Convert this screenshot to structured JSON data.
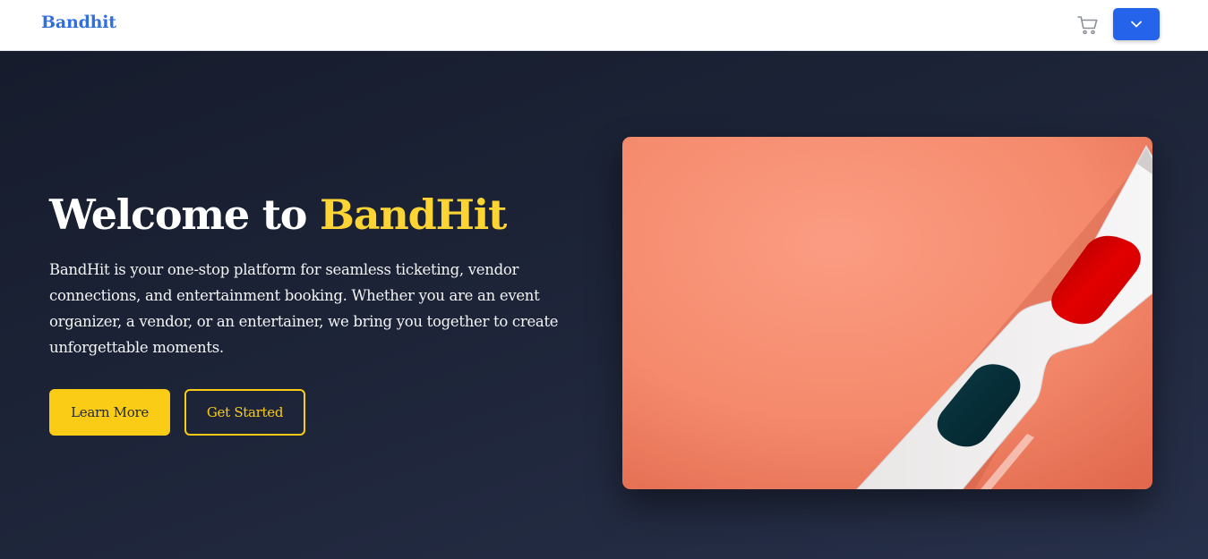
{
  "navbar": {
    "brand": "Bandhit",
    "icons": {
      "cart": "cart-icon",
      "menu": "chevron-down-icon"
    },
    "colors": {
      "brand": "#2f6fde",
      "menu_button": "#2563eb"
    }
  },
  "hero": {
    "title_prefix": "Welcome to ",
    "title_highlight": "BandHit",
    "description": "BandHit is your one-stop platform for seamless ticketing, vendor connections, and entertainment booking. Whether you are an event organizer, a vendor, or an entertainer, we bring you together to create unforgettable moments.",
    "primary_button": "Learn More",
    "secondary_button": "Get Started",
    "image_subject": "3d-glasses-image",
    "colors": {
      "accent": "#fcd535",
      "button": "#facc15",
      "background": "#1d2438",
      "image_background": "#f4876a"
    }
  }
}
